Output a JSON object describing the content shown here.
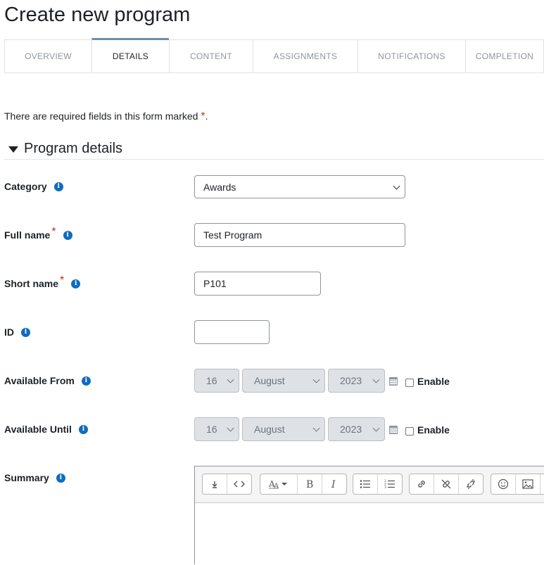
{
  "page": {
    "title": "Create new program"
  },
  "tabs": [
    {
      "label": "OVERVIEW",
      "active": false
    },
    {
      "label": "DETAILS",
      "active": true
    },
    {
      "label": "CONTENT",
      "active": false
    },
    {
      "label": "ASSIGNMENTS",
      "active": false
    },
    {
      "label": "NOTIFICATIONS",
      "active": false
    },
    {
      "label": "COMPLETION",
      "active": false
    }
  ],
  "form": {
    "required_note": "There are required fields in this form marked",
    "required_marker": "*",
    "required_note_end": ".",
    "section_title": "Program details",
    "category": {
      "label": "Category",
      "value": "Awards"
    },
    "full_name": {
      "label": "Full name",
      "value": "Test Program"
    },
    "short_name": {
      "label": "Short name",
      "value": "P101"
    },
    "id_number": {
      "label": "ID",
      "value": ""
    },
    "available_from": {
      "label": "Available From",
      "day": "16",
      "month": "August",
      "year": "2023",
      "enable_label": "Enable",
      "enabled": false
    },
    "available_until": {
      "label": "Available Until",
      "day": "16",
      "month": "August",
      "year": "2023",
      "enable_label": "Enable",
      "enabled": false
    },
    "summary": {
      "label": "Summary"
    }
  },
  "colors": {
    "info": "#0f6cbf",
    "required": "#c2341a",
    "tab_active_border": "#6f8fa8",
    "disabled_bg": "#dee2e6"
  },
  "icons": {
    "info": "info-icon",
    "collapse": "caret-down-icon",
    "calendar": "calendar-icon",
    "toolbar": [
      "collapse-toolbar-icon",
      "code-icon",
      "font-style-icon",
      "bold-icon",
      "italic-icon",
      "unordered-list-icon",
      "ordered-list-icon",
      "link-icon",
      "unlink-icon",
      "unlink-alt-icon",
      "emoji-icon",
      "image-icon"
    ]
  }
}
